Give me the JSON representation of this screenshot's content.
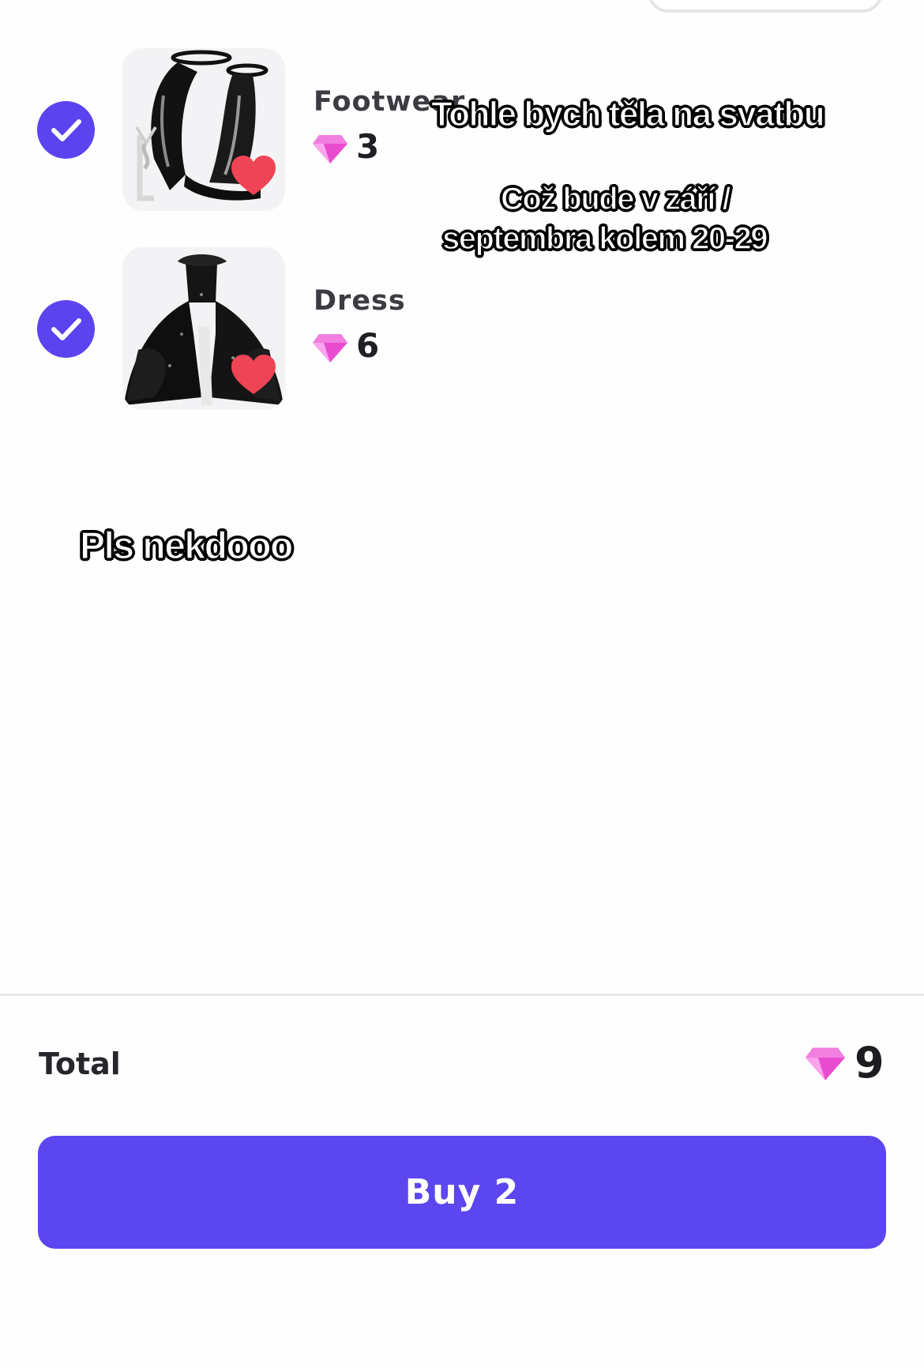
{
  "items": [
    {
      "category": "Footwear",
      "price": "3",
      "selected": true
    },
    {
      "category": "Dress",
      "price": "6",
      "selected": true
    }
  ],
  "captions": {
    "top_line1": "Tohle bych těla na svatbu",
    "top_line2": "Což bude v září /",
    "top_line3": "septembra kolem 20-29",
    "middle": "Pls nekdooo"
  },
  "summary": {
    "total_label": "Total",
    "total_value": "9",
    "buy_label": "Buy 2"
  },
  "colors": {
    "accent": "#5c46f0",
    "gem": "#e94bd0",
    "heart": "#ee4455"
  }
}
